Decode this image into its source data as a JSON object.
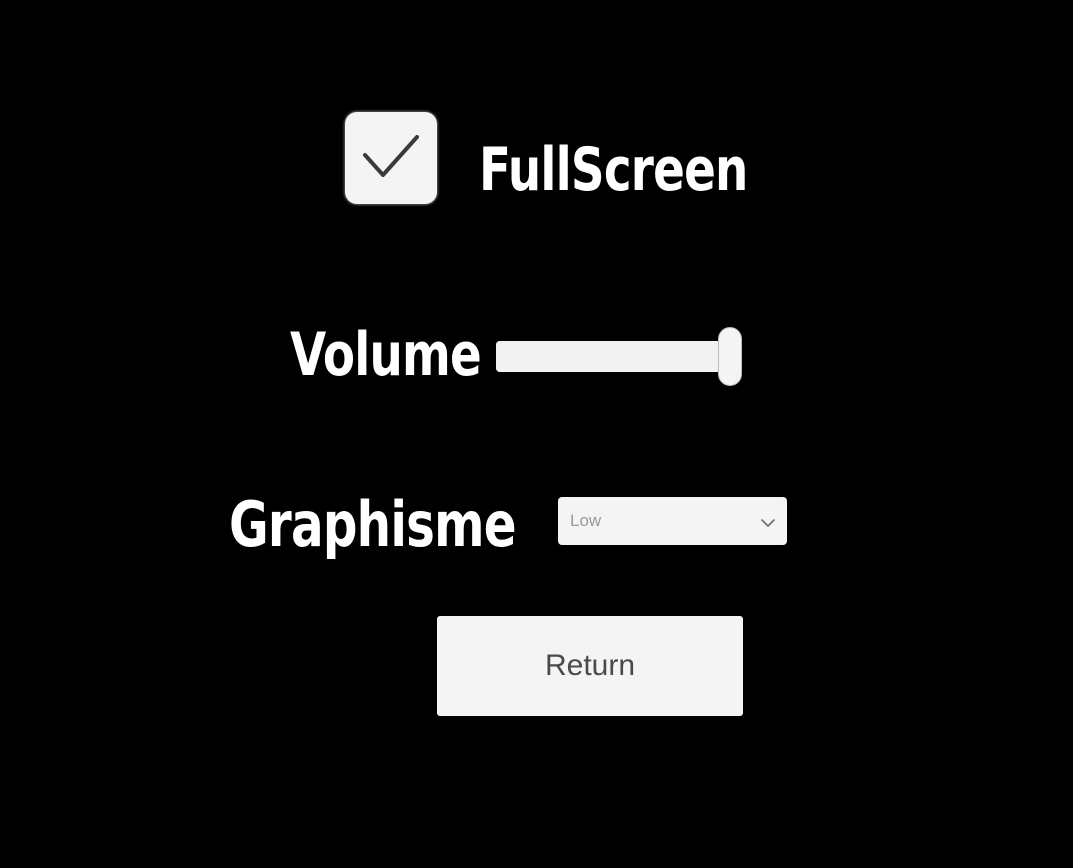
{
  "settings": {
    "fullscreen": {
      "label": "FullScreen",
      "checked": true,
      "icon": "checkmark-icon"
    },
    "volume": {
      "label": "Volume",
      "level": 1.0
    },
    "graphics": {
      "label": "Graphisme",
      "selected": "Low",
      "icon": "chevron-down-icon"
    },
    "return_button": {
      "label": "Return"
    }
  },
  "colors": {
    "background": "#000000",
    "text": "#ffffff",
    "control_bg": "#f4f4f4",
    "button_text": "#4a4a4a",
    "dropdown_text": "#9a9a9a"
  }
}
